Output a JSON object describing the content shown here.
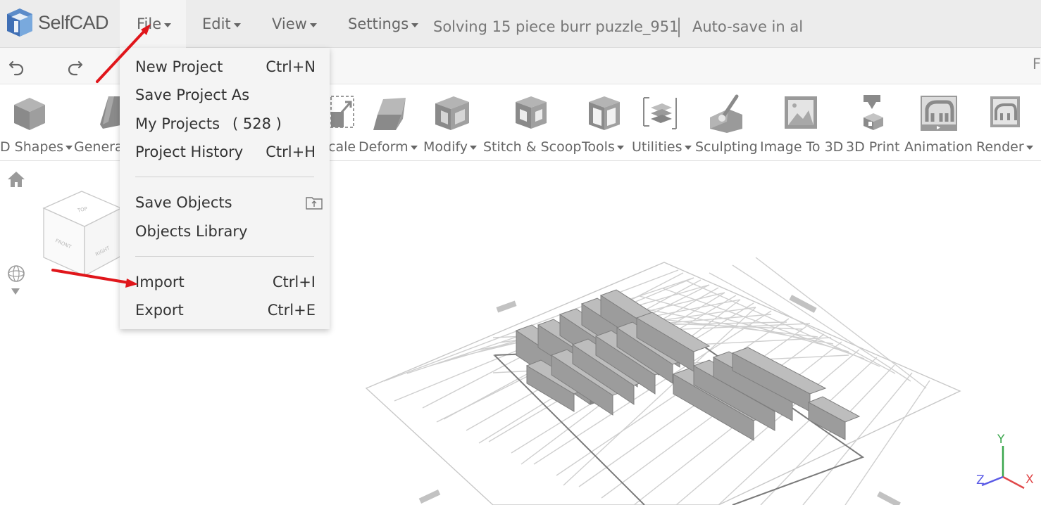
{
  "app": {
    "brand": "SelfCAD",
    "project_title": "Solving 15 piece burr puzzle_951",
    "autosave": "Auto-save in al",
    "row2_right": "F"
  },
  "menubar": {
    "file": "File",
    "edit": "Edit",
    "view": "View",
    "settings": "Settings"
  },
  "toolbar": [
    {
      "label": "D Shapes",
      "icon": "cube-icon",
      "dropdown": true
    },
    {
      "label": "Genera",
      "icon": "generator-icon",
      "dropdown": false
    },
    {
      "label": "cale",
      "icon": "scale-icon",
      "dropdown": false
    },
    {
      "label": "Deform",
      "icon": "deform-icon",
      "dropdown": true
    },
    {
      "label": "Modify",
      "icon": "modify-icon",
      "dropdown": true
    },
    {
      "label": "Stitch & Scoop",
      "icon": "stitch-scoop-icon",
      "dropdown": false
    },
    {
      "label": "Tools",
      "icon": "tools-icon",
      "dropdown": true
    },
    {
      "label": "Utilities",
      "icon": "utilities-icon",
      "dropdown": true
    },
    {
      "label": "Sculpting",
      "icon": "sculpting-icon",
      "dropdown": false
    },
    {
      "label": "Image To 3D",
      "icon": "image-to-3d-icon",
      "dropdown": false
    },
    {
      "label": "3D Print",
      "icon": "3d-print-icon",
      "dropdown": false
    },
    {
      "label": "Animation",
      "icon": "animation-icon",
      "dropdown": false
    },
    {
      "label": "Render",
      "icon": "render-icon",
      "dropdown": true
    }
  ],
  "file_menu": {
    "new_project": {
      "label": "New Project",
      "shortcut": "Ctrl+N"
    },
    "save_project_as": {
      "label": "Save Project As"
    },
    "my_projects": {
      "label": "My Projects",
      "count": "( 528 )"
    },
    "project_history": {
      "label": "Project History",
      "shortcut": "Ctrl+H"
    },
    "save_objects": {
      "label": "Save Objects",
      "icon": "folder-upload-icon"
    },
    "objects_library": {
      "label": "Objects Library"
    },
    "import": {
      "label": "Import",
      "shortcut": "Ctrl+I"
    },
    "export": {
      "label": "Export",
      "shortcut": "Ctrl+E"
    }
  },
  "nav_cube": {
    "top": "TOP",
    "front": "FRONT",
    "right": "RIGHT"
  },
  "axes": {
    "x": "X",
    "y": "Y",
    "z": "Z"
  },
  "colors": {
    "annotation_arrow": "#e0161b",
    "axis_x": "#e0484a",
    "axis_y": "#3aa64c",
    "axis_z": "#5a5ae6"
  }
}
